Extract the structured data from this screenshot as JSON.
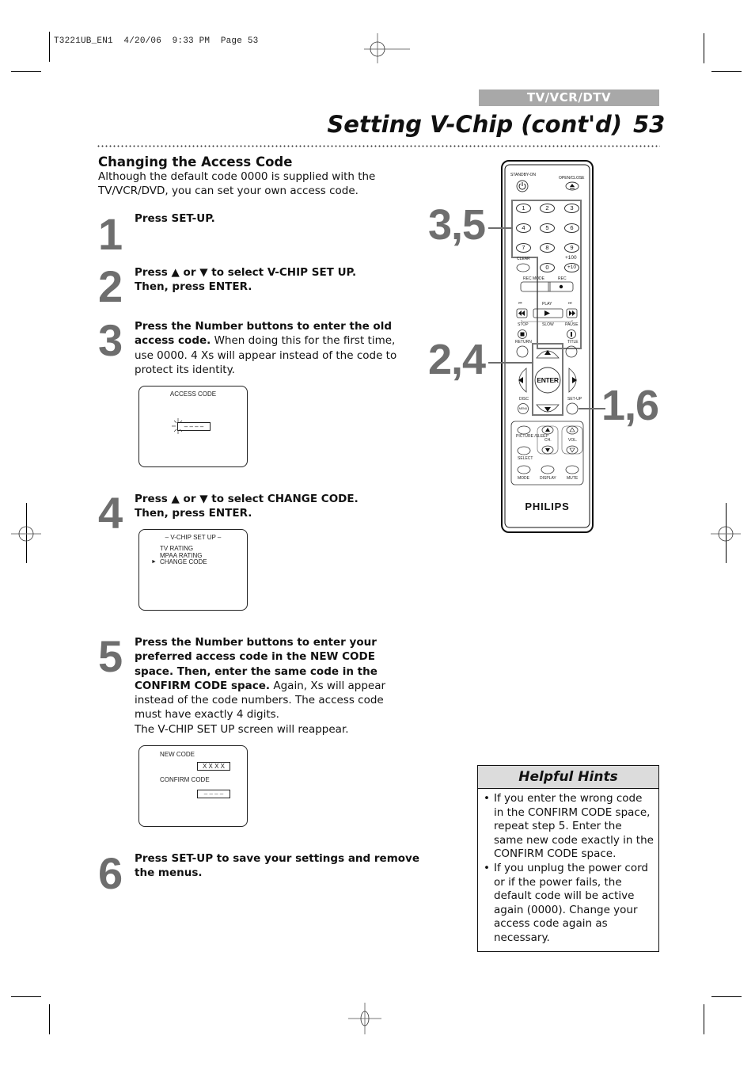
{
  "print_slug": "T3221UB_EN1  4/20/06  9:33 PM  Page 53",
  "section_tab": "TV/VCR/DTV",
  "page_title": "Setting V-Chip (cont'd)",
  "page_number": "53",
  "section": {
    "heading": "Changing the Access Code",
    "intro": "Although the default code 0000 is supplied with the TV/VCR/DVD, you can set your own access code."
  },
  "steps": [
    {
      "number": "1",
      "bold": "Press SET-UP.",
      "normal": ""
    },
    {
      "number": "2",
      "bold_a": "Press ▲ or ▼ to select V-CHIP SET UP.",
      "bold_b": "Then, press ENTER."
    },
    {
      "number": "3",
      "bold": "Press the Number buttons to enter the old access code.",
      "normal": " When doing this for the first time, use 0000. 4 Xs will appear instead of the code to protect its identity."
    },
    {
      "number": "4",
      "bold_a": "Press ▲ or ▼ to select CHANGE CODE.",
      "bold_b": "Then, press ENTER."
    },
    {
      "number": "5",
      "bold": "Press the Number buttons to enter your preferred access code in the NEW CODE space. Then, enter the same code in the CONFIRM CODE space.",
      "normal": " Again, Xs will appear instead of the code numbers. The access code must have exactly 4 digits.",
      "extra": "The V-CHIP SET UP screen will reappear."
    },
    {
      "number": "6",
      "bold": "Press SET-UP to save your settings and remove the menus.",
      "normal": ""
    }
  ],
  "screens": {
    "access_code": {
      "title": "ACCESS CODE",
      "field": "– – – –"
    },
    "vchip_setup": {
      "title": "– V-CHIP SET UP –",
      "items": [
        "TV RATING",
        "MPAA RATING",
        "CHANGE CODE"
      ],
      "cursor": "►",
      "selected_index": 2
    },
    "new_code": {
      "new_label": "NEW CODE",
      "new_value": "X X X X",
      "confirm_label": "CONFIRM CODE",
      "confirm_value": "– – – –"
    }
  },
  "remote": {
    "brand": "PHILIPS",
    "labels": {
      "standby": "STANDBY-ON",
      "open_close": "OPEN/CLOSE",
      "clear": "CLEAR",
      "plus100": "+100",
      "plus10": "+10",
      "rec_mode": "REC MODE",
      "rec": "REC",
      "play": "PLAY",
      "stop": "STOP",
      "slow": "SLOW",
      "pause": "PAUSE",
      "return": "RETURN",
      "title": "TITLE",
      "enter": "ENTER",
      "disc": "DISC",
      "menu": "MENU",
      "setup": "SET-UP",
      "picture_sleep": "PICTURE /SLEEP",
      "ch": "CH.",
      "vol": "VOL.",
      "select": "SELECT",
      "mode": "MODE",
      "display": "DISPLAY",
      "mute": "MUTE"
    },
    "digits": [
      "1",
      "2",
      "3",
      "4",
      "5",
      "6",
      "7",
      "8",
      "9",
      "0"
    ]
  },
  "callouts": [
    "3,5",
    "2,4",
    "1,6"
  ],
  "hints": {
    "title": "Helpful Hints",
    "items": [
      "If you enter the wrong code in the CONFIRM CODE space, repeat step 5. Enter the same new code exactly in the CONFIRM CODE space.",
      "If you unplug the power cord or if the power fails, the default code will be active again (0000). Change your access code again as necessary."
    ]
  }
}
